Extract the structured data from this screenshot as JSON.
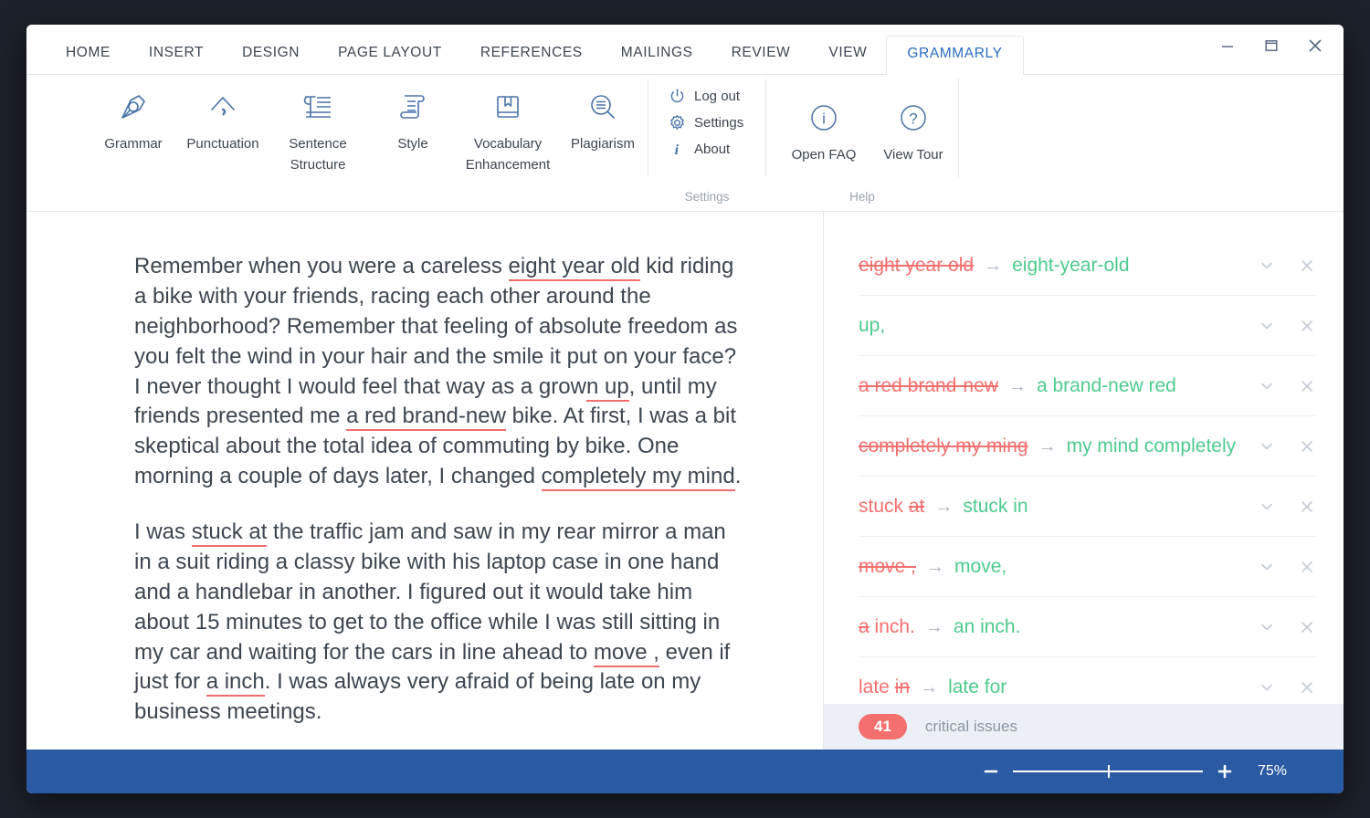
{
  "window": {
    "controls": [
      {
        "name": "minimize",
        "icon": "minimize-icon"
      },
      {
        "name": "maximize",
        "icon": "maximize-icon"
      },
      {
        "name": "close",
        "icon": "close-icon"
      }
    ],
    "accent_blue": "#2b6cc4",
    "statusbar_blue": "#2b5aa5"
  },
  "ribbon_tabs": [
    {
      "label": "HOME",
      "active": false
    },
    {
      "label": "INSERT",
      "active": false
    },
    {
      "label": "DESIGN",
      "active": false
    },
    {
      "label": "PAGE LAYOUT",
      "active": false
    },
    {
      "label": "REFERENCES",
      "active": false
    },
    {
      "label": "MAILINGS",
      "active": false
    },
    {
      "label": "REVIEW",
      "active": false
    },
    {
      "label": "VIEW",
      "active": false
    },
    {
      "label": "GRAMMARLY",
      "active": true
    }
  ],
  "ribbon": {
    "checks": [
      {
        "label": "Grammar",
        "icon": "pen-nib-icon"
      },
      {
        "label": "Punctuation",
        "icon": "comma-caret-icon"
      },
      {
        "label": "Sentence Structure",
        "icon": "paragraph-lines-icon"
      },
      {
        "label": "Style",
        "icon": "scroll-icon"
      },
      {
        "label": "Vocabulary Enhancement",
        "icon": "book-bookmark-icon"
      },
      {
        "label": "Plagiarism",
        "icon": "magnifier-text-icon"
      }
    ],
    "settings_group": {
      "caption": "Settings",
      "items": [
        {
          "label": "Log out",
          "icon": "power-icon"
        },
        {
          "label": "Settings",
          "icon": "gear-icon"
        },
        {
          "label": "About",
          "icon": "info-italic-icon"
        }
      ]
    },
    "help_group": {
      "caption": "Help",
      "items": [
        {
          "label": "Open FAQ",
          "icon": "info-circle-icon"
        },
        {
          "label": "View Tour",
          "icon": "question-circle-icon"
        }
      ]
    }
  },
  "document": {
    "paragraphs": [
      {
        "runs": [
          {
            "text": "Remember when you were a careless ",
            "flag": false
          },
          {
            "text": "eight year old",
            "flag": true
          },
          {
            "text": " kid riding a bike with your friends, racing each other around the neighborhood? Remember that feeling of absolute freedom as you felt the wind in your hair and the smile it put on your face? I never thought I would feel that way as a grow",
            "flag": false
          },
          {
            "text": "n up",
            "flag": true
          },
          {
            "text": ", until my friends presented me ",
            "flag": false
          },
          {
            "text": "a red brand-new",
            "flag": true
          },
          {
            "text": " bike. At first, I was a bit skeptical about the total idea of commuting by bike. One morning a couple of days later, I changed ",
            "flag": false
          },
          {
            "text": "completely my mind",
            "flag": true
          },
          {
            "text": ".",
            "flag": false
          }
        ]
      },
      {
        "runs": [
          {
            "text": "I was ",
            "flag": false
          },
          {
            "text": "stuck at",
            "flag": true
          },
          {
            "text": " the traffic jam and saw in my rear mirror a man in a suit riding a classy bike with his laptop case in one hand and a handlebar in another. I figured out it would take him about 15 minutes to get to the office while I was still sitting in my car and waiting for the cars in line ahead to ",
            "flag": false
          },
          {
            "text": "move ,",
            "flag": true
          },
          {
            "text": " even if just for ",
            "flag": false
          },
          {
            "text": "a inch",
            "flag": true
          },
          {
            "text": ". I was always very afraid of being late on my business meetings.",
            "flag": false
          }
        ]
      }
    ]
  },
  "suggestions": {
    "cards": [
      {
        "old": "eight year old",
        "old_struck": true,
        "old_suffix": "",
        "arrow": "→",
        "new": "eight-year-old"
      },
      {
        "old": "",
        "old_struck": false,
        "old_suffix": "",
        "arrow": "",
        "new": "up,"
      },
      {
        "old": "a red brand-new",
        "old_struck": true,
        "old_suffix": "",
        "arrow": "→",
        "new": "a brand-new red"
      },
      {
        "old": "completely my ming",
        "old_struck": true,
        "old_suffix": "",
        "arrow": "→",
        "new": "my mind completely"
      },
      {
        "old": "at",
        "old_struck": true,
        "old_prefix": "stuck ",
        "arrow": "→",
        "new": "stuck in"
      },
      {
        "old": "move ,",
        "old_struck": true,
        "old_suffix": "",
        "arrow": "→",
        "new": "move,"
      },
      {
        "old": "a",
        "old_struck": true,
        "old_prefix": "",
        "old_suffix": " inch.",
        "arrow": "→",
        "new": "an inch."
      },
      {
        "old": "in",
        "old_struck": true,
        "old_prefix": "late ",
        "arrow": "→",
        "new": "late for"
      }
    ],
    "card_buttons": [
      {
        "icon": "chevron-down-icon",
        "name": "expand-card-button"
      },
      {
        "icon": "close-icon",
        "name": "dismiss-card-button"
      }
    ],
    "issue_count": "41",
    "issue_label": "critical issues",
    "badge_color": "#f4706f"
  },
  "statusbar": {
    "zoom_out_icon": "minus-icon",
    "zoom_in_icon": "plus-icon",
    "zoom_value": "75%"
  }
}
